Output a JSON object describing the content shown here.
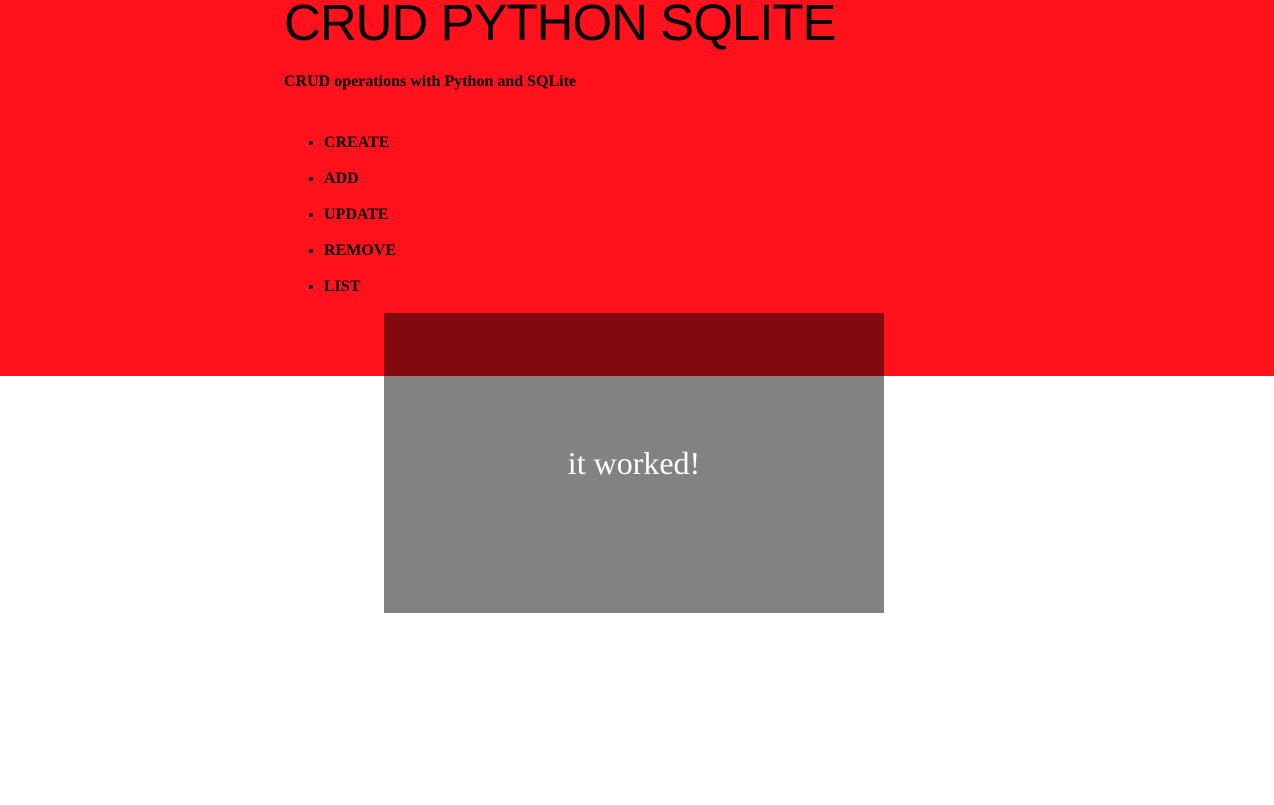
{
  "header": {
    "title": "CRUD PYTHON SQLITE",
    "subtitle": "CRUD operations with Python and SQLite",
    "background_color": "#ff121b"
  },
  "menu": {
    "items": [
      {
        "label": "CREATE"
      },
      {
        "label": "ADD"
      },
      {
        "label": "UPDATE"
      },
      {
        "label": "REMOVE"
      },
      {
        "label": "LIST"
      }
    ]
  },
  "overlay": {
    "message": "it worked!",
    "background_color": "rgba(0,0,0,0.49)"
  }
}
